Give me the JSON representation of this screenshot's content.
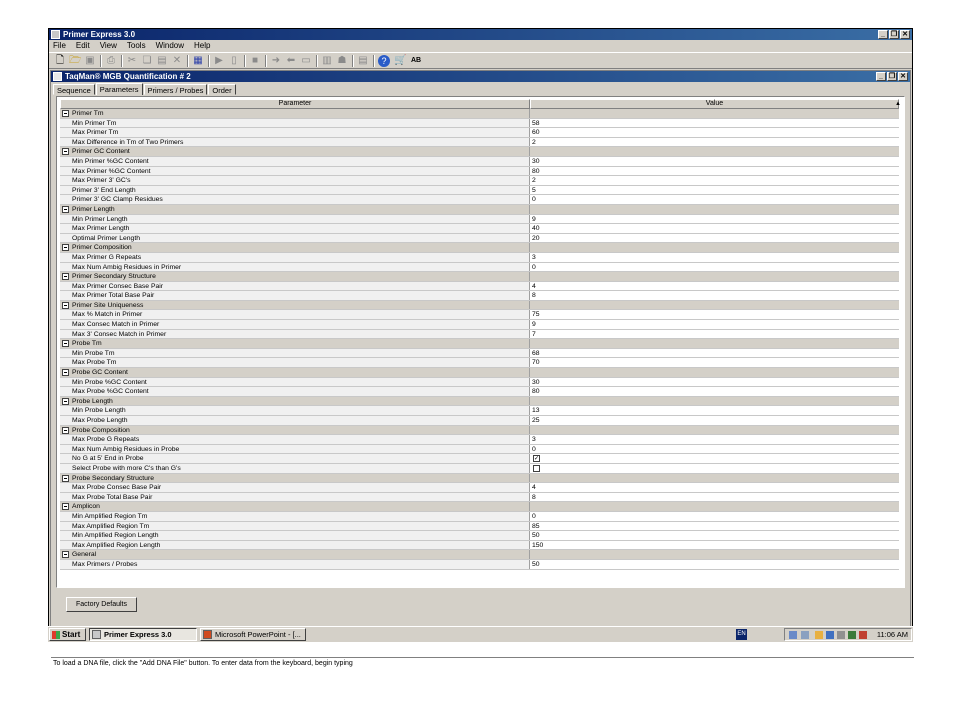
{
  "app": {
    "title": "Primer Express 3.0"
  },
  "menu": [
    "File",
    "Edit",
    "View",
    "Tools",
    "Window",
    "Help"
  ],
  "toolbar_icons": [
    "new-icon",
    "open-icon",
    "save-icon",
    "print-icon",
    "cut-icon",
    "copy-icon",
    "paste-icon",
    "delete-icon",
    "grid-icon",
    "play-icon",
    "page-icon",
    "stop-icon",
    "forward-arrow-icon",
    "back-arrow-icon",
    "window-icon",
    "list-icon",
    "tree-icon",
    "table-icon",
    "help-icon",
    "cart-icon",
    "ab-icon"
  ],
  "document": {
    "title": "TaqMan® MGB Quantification # 2",
    "tabs": [
      "Sequence",
      "Parameters",
      "Primers / Probes",
      "Order"
    ],
    "active_tab": "Parameters"
  },
  "grid": {
    "header_param": "Parameter",
    "header_value": "Value",
    "rows": [
      {
        "t": "g",
        "label": "Primer Tm"
      },
      {
        "t": "i",
        "label": "Min Primer Tm",
        "value": "58"
      },
      {
        "t": "i",
        "label": "Max Primer Tm",
        "value": "60"
      },
      {
        "t": "i",
        "label": "Max Difference in Tm of Two Primers",
        "value": "2"
      },
      {
        "t": "g",
        "label": "Primer GC Content"
      },
      {
        "t": "i",
        "label": "Min Primer %GC Content",
        "value": "30"
      },
      {
        "t": "i",
        "label": "Max Primer %GC Content",
        "value": "80"
      },
      {
        "t": "i",
        "label": "Max Primer 3' GC's",
        "value": "2"
      },
      {
        "t": "i",
        "label": "Primer 3' End Length",
        "value": "5"
      },
      {
        "t": "i",
        "label": "Primer 3' GC Clamp Residues",
        "value": "0"
      },
      {
        "t": "g",
        "label": "Primer Length"
      },
      {
        "t": "i",
        "label": "Min Primer Length",
        "value": "9"
      },
      {
        "t": "i",
        "label": "Max Primer Length",
        "value": "40"
      },
      {
        "t": "i",
        "label": "Optimal Primer Length",
        "value": "20"
      },
      {
        "t": "g",
        "label": "Primer Composition"
      },
      {
        "t": "i",
        "label": "Max Primer G Repeats",
        "value": "3"
      },
      {
        "t": "i",
        "label": "Max Num Ambig Residues in Primer",
        "value": "0"
      },
      {
        "t": "g",
        "label": "Primer Secondary Structure"
      },
      {
        "t": "i",
        "label": "Max Primer Consec Base Pair",
        "value": "4"
      },
      {
        "t": "i",
        "label": "Max Primer Total Base Pair",
        "value": "8"
      },
      {
        "t": "g",
        "label": "Primer Site Uniqueness"
      },
      {
        "t": "i",
        "label": "Max % Match in Primer",
        "value": "75"
      },
      {
        "t": "i",
        "label": "Max Consec Match in Primer",
        "value": "9"
      },
      {
        "t": "i",
        "label": "Max 3' Consec Match in Primer",
        "value": "7"
      },
      {
        "t": "g",
        "label": "Probe Tm"
      },
      {
        "t": "i",
        "label": "Min Probe Tm",
        "value": "68"
      },
      {
        "t": "i",
        "label": "Max Probe Tm",
        "value": "70"
      },
      {
        "t": "g",
        "label": "Probe GC Content"
      },
      {
        "t": "i",
        "label": "Min Probe %GC Content",
        "value": "30"
      },
      {
        "t": "i",
        "label": "Max Probe %GC Content",
        "value": "80"
      },
      {
        "t": "g",
        "label": "Probe Length"
      },
      {
        "t": "i",
        "label": "Min Probe Length",
        "value": "13"
      },
      {
        "t": "i",
        "label": "Max Probe Length",
        "value": "25"
      },
      {
        "t": "g",
        "label": "Probe Composition"
      },
      {
        "t": "i",
        "label": "Max Probe G Repeats",
        "value": "3"
      },
      {
        "t": "i",
        "label": "Max Num Ambig Residues in Probe",
        "value": "0"
      },
      {
        "t": "c",
        "label": "No G at 5' End in Probe",
        "checked": true
      },
      {
        "t": "c",
        "label": "Select Probe with more C's than G's",
        "checked": false
      },
      {
        "t": "g",
        "label": "Probe Secondary Structure"
      },
      {
        "t": "i",
        "label": "Max Probe Consec Base Pair",
        "value": "4"
      },
      {
        "t": "i",
        "label": "Max Probe Total Base Pair",
        "value": "8"
      },
      {
        "t": "g",
        "label": "Amplicon"
      },
      {
        "t": "i",
        "label": "Min Amplified Region Tm",
        "value": "0"
      },
      {
        "t": "i",
        "label": "Max Amplified Region Tm",
        "value": "85"
      },
      {
        "t": "i",
        "label": "Min Amplified Region Length",
        "value": "50"
      },
      {
        "t": "i",
        "label": "Max Amplified Region Length",
        "value": "150"
      },
      {
        "t": "g",
        "label": "General"
      },
      {
        "t": "i",
        "label": "Max Primers / Probes",
        "value": "50"
      }
    ]
  },
  "factory_defaults_label": "Factory Defaults",
  "status_text": "To load a DNA file, click the \"Add DNA File\" button. To enter data from the keyboard, begin typing",
  "taskbar": {
    "start_label": "Start",
    "tasks": [
      "Primer Express 3.0",
      "Microsoft PowerPoint - [..."
    ],
    "lang": "EN",
    "clock": "11:06 AM"
  },
  "colors": {
    "title_start": "#0a246a",
    "title_end": "#3a6ea5",
    "chrome": "#d4d0c8"
  }
}
